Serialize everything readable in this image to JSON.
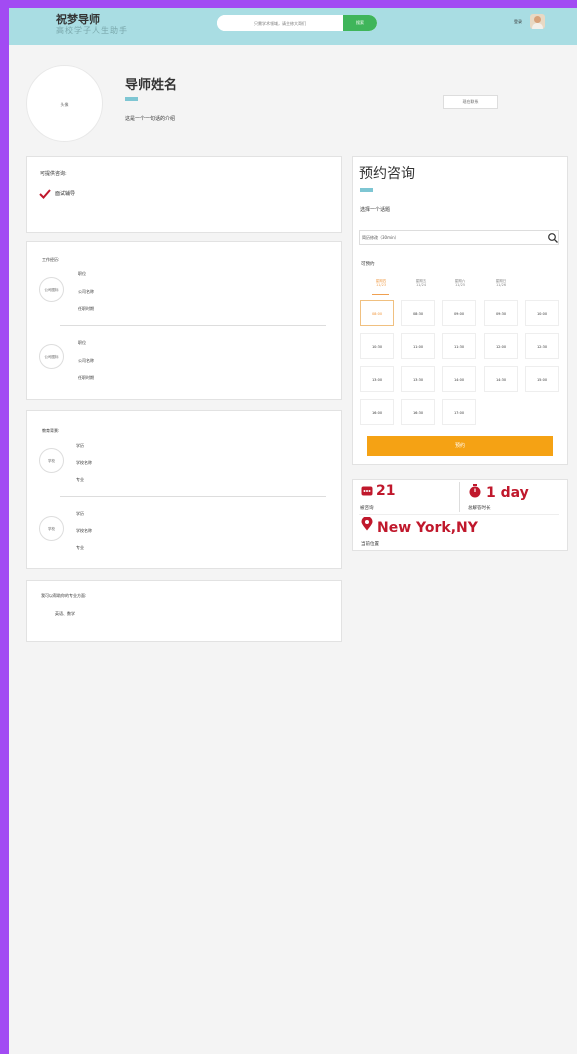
{
  "header": {
    "logo_title": "祝梦导师",
    "logo_subtitle": "高校学子人生助手",
    "search_placeholder": "只需学术领域，请主修大哥们",
    "search_button": "搜索",
    "login_text": "登录"
  },
  "profile": {
    "avatar_text": "头像",
    "name": "导师姓名",
    "intro": "这是一个一句话的介绍",
    "follow_button": "现在联系"
  },
  "consult": {
    "title": "可提供咨询:",
    "items": [
      "面试辅导"
    ]
  },
  "work": {
    "title": "工作经历:",
    "entries": [
      {
        "logo": "公司图标",
        "lines": [
          "职位",
          "公司名称",
          "任职时期"
        ]
      },
      {
        "logo": "公司图标",
        "lines": [
          "职位",
          "公司名称",
          "任职时期"
        ]
      }
    ]
  },
  "education": {
    "title": "教育背景:",
    "entries": [
      {
        "logo": "学校",
        "lines": [
          "学历",
          "学校名称",
          "专业"
        ]
      },
      {
        "logo": "学校",
        "lines": [
          "学历",
          "学校名称",
          "专业"
        ]
      }
    ]
  },
  "skills": {
    "title": "我可以帮助你的专业方面:",
    "content": "英语、数学"
  },
  "booking": {
    "title": "预约咨询",
    "choose_topic": "选择一个话题",
    "topic_value": "简历修改（30min）",
    "available_label": "可预约",
    "days": [
      {
        "weekday": "星期四",
        "date": "11/23"
      },
      {
        "weekday": "星期五",
        "date": "11/24"
      },
      {
        "weekday": "星期六",
        "date": "11/25"
      },
      {
        "weekday": "星期日",
        "date": "11/26"
      }
    ],
    "selected_day_index": 0,
    "time_slots": [
      "08:00",
      "08:30",
      "09:00",
      "09:30",
      "10:00",
      "10:30",
      "11:00",
      "11:30",
      "12:00",
      "12:30",
      "13:00",
      "13:30",
      "14:00",
      "14:30",
      "15:00",
      "16:00",
      "16:30",
      "17:00"
    ],
    "selected_slot_index": 0,
    "confirm_button": "预约"
  },
  "stats": {
    "consult_count": "21",
    "consult_label": "被咨询",
    "response_time": "1 day",
    "response_label": "总解答时长",
    "location": "New York,NY",
    "location_label": "当前位置"
  },
  "colors": {
    "header_bg": "#a9dde3",
    "accent_orange": "#f5a214",
    "accent_red": "#c0182c",
    "outer_bg": "#a24bf3",
    "underline": "#7ec6d3",
    "search_green": "#3fb55a"
  }
}
